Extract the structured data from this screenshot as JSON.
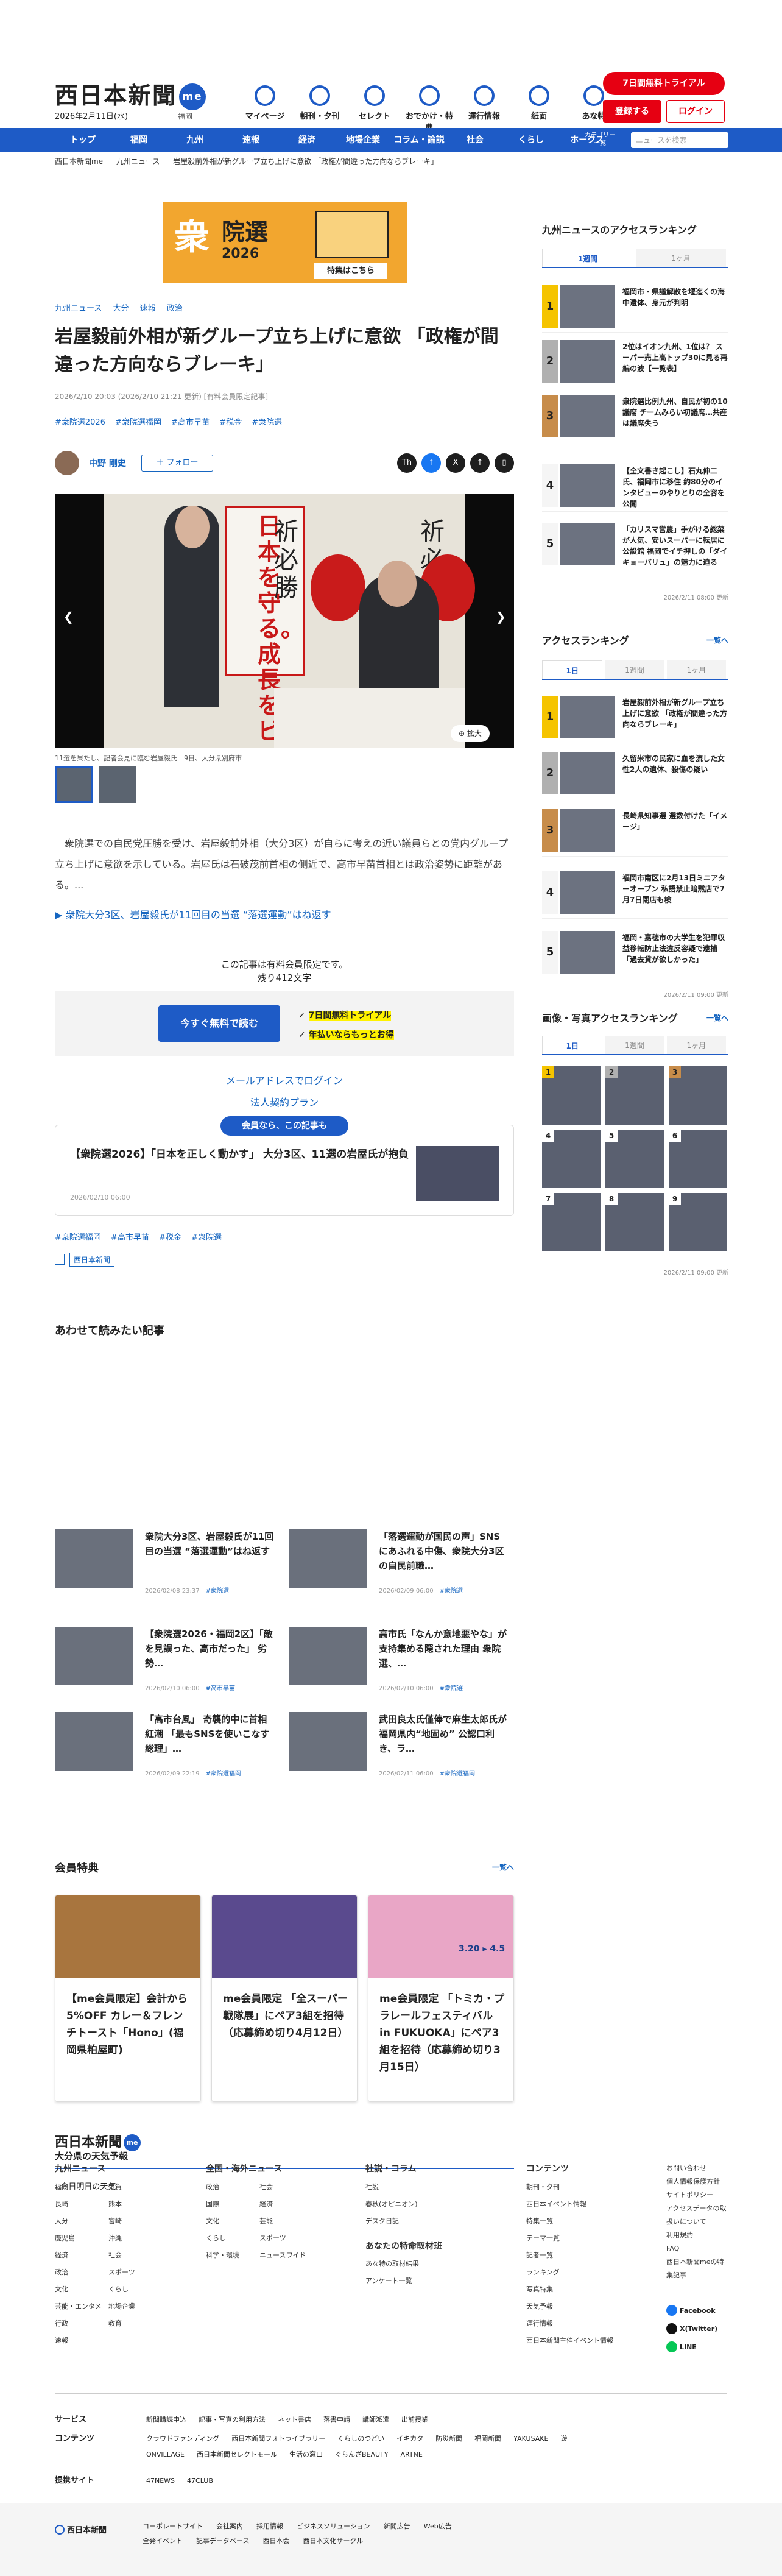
{
  "header": {
    "logo": "西日本新聞",
    "logo_badge": "me",
    "date": "2026年2月11日(水)",
    "region": "福岡",
    "icons": [
      "マイページ",
      "朝刊・夕刊",
      "セレクト",
      "おでかけ・特典",
      "運行情報",
      "紙面",
      "あな特"
    ],
    "trial": "7日間無料トライアル",
    "register": "登録する",
    "login": "ログイン"
  },
  "nav": {
    "items": [
      "トップ",
      "福岡",
      "九州",
      "速報",
      "経済",
      "地場企業",
      "コラム・論説",
      "社会",
      "くらし",
      "ホークス"
    ],
    "category": "カテゴリー一覧",
    "search_placeholder": "ニュースを検索"
  },
  "breadcrumb": [
    "西日本新聞me",
    "九州ニュース",
    "岩屋毅前外相が新グループ立ち上げに意欲 「政権が間違った方向ならブレーキ」"
  ],
  "banner": {
    "kanji": "衆",
    "line1": "院選",
    "line2": "2026",
    "cta": "特集はこちら"
  },
  "article": {
    "tags": [
      "九州ニュース",
      "大分",
      "速報",
      "政治"
    ],
    "title": "岩屋毅前外相が新グループ立ち上げに意欲 「政権が間違った方向ならブレーキ」",
    "meta": "2026/2/10 20:03 (2026/2/10 21:21 更新) [有料会員限定記事]",
    "hashtags": [
      "#衆院選2026",
      "#衆院選福岡",
      "#高市早苗",
      "#税金",
      "#衆院選"
    ],
    "author": "中野 剛史",
    "follow": "＋ フォロー",
    "share": [
      "Th",
      "f",
      "X",
      "↑",
      "▯"
    ],
    "photo_sign": "日本を守る。成長をビコ。",
    "photo_banners": [
      "祈必勝",
      "祈必勝"
    ],
    "zoom": "拡大",
    "caption": "11選を果たし、記者会見に臨む岩屋毅氏＝9日、大分県別府市",
    "lead": "衆院選での自民党圧勝を受け、岩屋毅前外相（大分3区）が自らに考えの近い議員らとの党内グループ立ち上げに意欲を示している。岩屋氏は石破茂前首相の側近で、高市早苗首相とは政治姿勢に距離がある。...",
    "related": "衆院大分3区、岩屋毅氏が11回目の当選 “落選運動”はね返す",
    "limit_line1": "この記事は有料会員限定です。",
    "limit_line2": "残り412文字",
    "cta": "今すぐ無料で読む",
    "check1": "7日間無料トライアル",
    "check2": "年払いならもっとお得",
    "mail_login": "メールアドレスでログイン",
    "corporate": "法人契約プラン",
    "members_badge": "会員なら、この記事も",
    "member_card_title": "【衆院選2026】「日本を正しく動かす」 大分3区、11選の岩屋氏が抱負",
    "member_card_date": "2026/02/10 06:00",
    "bottom_tags": [
      "#衆院選福岡",
      "#高市早苗",
      "#税金",
      "#衆院選"
    ],
    "source": "西日本新聞"
  },
  "recommend": {
    "heading": "あわせて読みたい記事",
    "items": [
      {
        "title": "衆院大分3区、岩屋毅氏が11回目の当選 “落選運動”はね返す",
        "date": "2026/02/08 23:37",
        "tag": "#衆院選"
      },
      {
        "title": "「落選運動が国民の声」SNSにあふれる中傷、衆院大分3区の自民前職…",
        "date": "2026/02/09 06:00",
        "tag": "#衆院選"
      },
      {
        "title": "【衆院選2026・福岡2区】「敵を見誤った、高市だった」 劣勢…",
        "date": "2026/02/10 06:00",
        "tag": "#高市早苗"
      },
      {
        "title": "高市氏「なんか意地悪やな」が支持集める隠された理由 衆院選、…",
        "date": "2026/02/10 06:00",
        "tag": "#衆院選"
      },
      {
        "title": "「高市台風」 奇襲的中に首相紅潮 「最もSNSを使いこなす総理」…",
        "date": "2026/02/09 22:19",
        "tag": "#衆院選福岡"
      },
      {
        "title": "武田良太氏僅俸で麻生太郎氏が福岡県内“地固め” 公認口利き、ラ…",
        "date": "2026/02/11 06:00",
        "tag": "#衆院選福岡"
      }
    ]
  },
  "perks": {
    "heading": "会員特典",
    "more": "一覧へ",
    "items": [
      {
        "title": "【me会員限定】会計から5%OFF カレー＆フレンチトースト「Hono」(福岡県粕屋町)"
      },
      {
        "title": "me会員限定 「全スーパー戦隊展」にペア3組を招待（応募締め切り4月12日）"
      },
      {
        "title": "me会員限定 「トミカ・プラレールフェスティバル in FUKUOKA」にペア3組を招待（応募締め切り3月15日）",
        "date_badge": "3.20 ▸ 4.5"
      }
    ]
  },
  "weather": {
    "heading": "大分県の天気予報",
    "sub": "今日明日の天気"
  },
  "side": {
    "kyushu": {
      "heading": "九州ニュースのアクセスランキング",
      "tabs": [
        "1週間",
        "1ヶ月"
      ],
      "items": [
        "福岡市・県議解散を堰迄くの海中遺体、身元が判明",
        "2位はイオン九州、1位は？ スーパー売上高トップ30に見る再編の波【一覧表】",
        "衆院選比例九州、自民が初の10議席 チームみらい初議席…共産は議席失う",
        "【全文書き起こし】石丸伸二氏、福岡市に移住 約80分のインタビューのやりとりの全容を公開",
        "「カリスマ営農」手がける総菜が人気、安いスーパーに転居に公設館 福岡でイチ押しの「ダイキョーバリュ」の魅力に迫る"
      ],
      "updated": "2026/2/11 08:00 更新"
    },
    "access": {
      "heading": "アクセスランキング",
      "more": "一覧へ",
      "tabs": [
        "1日",
        "1週間",
        "1ヶ月"
      ],
      "items": [
        "岩屋毅前外相が新グループ立ち上げに意欲 「政権が間違った方向ならブレーキ」",
        "久留米市の民家に血を流した女性2人の遺体、殺傷の疑い",
        "長崎県知事選 選数付けた「イメージ」",
        "福岡市南区に2月13日ミニアターオープン 私語禁止暗黙店で7月7日閉店も検",
        "福岡・嘉穂市の大学生を犯罪収益移転防止法違反容疑で逮捕「過去貸が欲しかった」"
      ],
      "updated": "2026/2/11 09:00 更新"
    },
    "photo": {
      "heading": "画像・写真アクセスランキング",
      "more": "一覧へ",
      "tabs": [
        "1日",
        "1週間",
        "1ヶ月"
      ],
      "labels": [
        "1",
        "2",
        "3",
        "4",
        "5",
        "6",
        "7",
        "8",
        "9"
      ],
      "updated": "2026/2/11 09:00 更新"
    }
  },
  "footer": {
    "logo": "西日本新聞",
    "logo_badge": "me",
    "cols": [
      {
        "h": "九州ニュース",
        "items": [
          "福岡",
          "佐賀",
          "長崎",
          "熊本",
          "大分",
          "宮崎",
          "鹿児島",
          "沖縄",
          "経済",
          "社会",
          "政治",
          "スポーツ",
          "文化",
          "くらし",
          "芸能・エンタメ",
          "地場企業",
          "行政",
          "教育",
          "速報"
        ]
      },
      {
        "h": "全国・海外ニュース",
        "items": [
          "政治",
          "社会",
          "国際",
          "経済",
          "文化",
          "芸能",
          "くらし",
          "スポーツ",
          "科学・環境",
          "ニュースワイド"
        ]
      },
      {
        "h": "社説・コラム",
        "items": [
          "社説",
          "春秋(オピニオン)",
          "デスク日記"
        ],
        "sub": "あなたの特命取材班",
        "sub_items": [
          "あな特の取材結果",
          "アンケート一覧"
        ]
      },
      {
        "h": "コンテンツ",
        "items": [
          "朝刊・夕刊",
          "西日本イベント情報",
          "特集一覧",
          "テーマ一覧",
          "記者一覧",
          "ランキング",
          "写真特集",
          "天気予報",
          "運行情報",
          "西日本新聞主催イベント情報"
        ]
      },
      {
        "h": "",
        "items": [
          "お問い合わせ",
          "個人情報保護方針",
          "サイトポリシー",
          "アクセスデータの取扱いについて",
          "利用規約",
          "FAQ",
          "西日本新聞meの特集記事"
        ]
      }
    ],
    "social": [
      "Facebook",
      "X(Twitter)",
      "LINE"
    ],
    "services_label": "サービス",
    "services": [
      "新聞購読申込",
      "記事・写真の利用方法",
      "ネット書店",
      "落書申請",
      "講師派遣",
      "出前授業"
    ],
    "contents_label": "コンテンツ",
    "contents": [
      "クラウドファンディング",
      "西日本新聞フォトライブラリー",
      "くらしのつどい",
      "イキカタ",
      "防災新聞",
      "福岡新聞",
      "YAKUSAKE",
      "遊ONVILLAGE",
      "西日本新聞セレクトモール",
      "生活の窓口",
      "ぐらんざBEAUTY",
      "ARTNE"
    ],
    "partners_label": "提携サイト",
    "partners": [
      "47NEWS",
      "47CLUB"
    ],
    "corp_name": "西日本新聞",
    "bottom1": [
      "コーポレートサイト",
      "会社案内",
      "採用情報",
      "ビジネスソリューション",
      "新聞広告",
      "Web広告"
    ],
    "bottom2": [
      "全発イベント",
      "記事データベース",
      "西日本会",
      "西日本文化サークル"
    ]
  }
}
